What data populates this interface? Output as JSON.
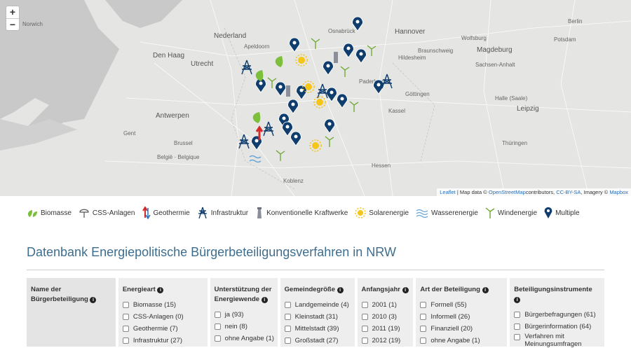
{
  "map": {
    "zoom_in": "+",
    "zoom_out": "−",
    "cities": [
      {
        "name": "Berlin",
        "cls": "big"
      },
      {
        "name": "Potsdam",
        "cls": ""
      },
      {
        "name": "Hannover",
        "cls": "big"
      },
      {
        "name": "Magdeburg",
        "cls": "big"
      },
      {
        "name": "Wolfsburg",
        "cls": ""
      },
      {
        "name": "Braunschweig",
        "cls": ""
      },
      {
        "name": "Hildesheim",
        "cls": ""
      },
      {
        "name": "Sachsen-Anhalt",
        "cls": ""
      },
      {
        "name": "Göttingen",
        "cls": ""
      },
      {
        "name": "Kassel",
        "cls": ""
      },
      {
        "name": "Halle (Saale)",
        "cls": ""
      },
      {
        "name": "Leipzig",
        "cls": "big"
      },
      {
        "name": "Nederland",
        "cls": "big"
      },
      {
        "name": "Den Haag",
        "cls": "big"
      },
      {
        "name": "Utrecht",
        "cls": "big"
      },
      {
        "name": "Antwerpen",
        "cls": "big"
      },
      {
        "name": "Gent",
        "cls": ""
      },
      {
        "name": "België · Belgique",
        "cls": ""
      },
      {
        "name": "Brussel",
        "cls": ""
      },
      {
        "name": "Koblenz",
        "cls": ""
      },
      {
        "name": "Hessen",
        "cls": ""
      },
      {
        "name": "Apeldoorn",
        "cls": ""
      },
      {
        "name": "Osnabrück",
        "cls": ""
      },
      {
        "name": "Paderborn",
        "cls": ""
      },
      {
        "name": "Norwich",
        "cls": ""
      },
      {
        "name": "Thüringen",
        "cls": ""
      }
    ],
    "attribution": {
      "leaflet": "Leaflet",
      "sep1": " | Map data © ",
      "osm": "OpenStreetMap",
      "sep2": "contributors, ",
      "ccbysa": "CC-BY-SA",
      "sep3": ", Imagery © ",
      "mapbox": "Mapbox"
    }
  },
  "legend": [
    {
      "icon": "biomass-icon",
      "label": "Biomasse"
    },
    {
      "icon": "css-icon",
      "label": "CSS-Anlagen"
    },
    {
      "icon": "geothermal-icon",
      "label": "Geothermie"
    },
    {
      "icon": "infrastructure-icon",
      "label": "Infrastruktur"
    },
    {
      "icon": "power-plant-icon",
      "label": "Konventionelle Kraftwerke"
    },
    {
      "icon": "solar-icon",
      "label": "Solarenergie"
    },
    {
      "icon": "water-icon",
      "label": "Wasserenergie"
    },
    {
      "icon": "wind-icon",
      "label": "Windenergie"
    },
    {
      "icon": "multiple-pin-icon",
      "label": "Multiple"
    }
  ],
  "title": "Datenbank Energiepolitische Bürgerbeteiligungsverfahren in NRW",
  "filters": {
    "name": {
      "label": "Name der Bürgerbeteiligung"
    },
    "energieart": {
      "label": "Energieart",
      "options": [
        "Biomasse (15)",
        "CSS-Anlagen (0)",
        "Geothermie (7)",
        "Infrastruktur (27)"
      ]
    },
    "unterstuetzung": {
      "label": "Unterstützung der Energiewende",
      "options": [
        "ja (93)",
        "nein (8)",
        "ohne Angabe (1)"
      ]
    },
    "gemeindegroesse": {
      "label": "Gemeindegröße",
      "options": [
        "Landgemeinde (4)",
        "Kleinstadt (31)",
        "Mittelstadt (39)",
        "Großstadt (27)"
      ]
    },
    "anfangsjahr": {
      "label": "Anfangsjahr",
      "options": [
        "2001 (1)",
        "2010 (3)",
        "2011 (19)",
        "2012 (19)"
      ]
    },
    "art": {
      "label": "Art der Beteiligung",
      "options": [
        "Formell (55)",
        "Informell (26)",
        "Finanziell (20)",
        "ohne Angabe (1)"
      ]
    },
    "instrumente": {
      "label": "Beteiligungsinstrumente",
      "options": [
        "Bürgerbefragungen (61)",
        "Bürgerinformation (64)",
        "Verfahren mit Meinungsumfragen"
      ]
    }
  },
  "colors": {
    "accent": "#3e6e8f",
    "pin": "#0e3d6e",
    "solar": "#f5c518",
    "bio": "#7cbf3a"
  }
}
